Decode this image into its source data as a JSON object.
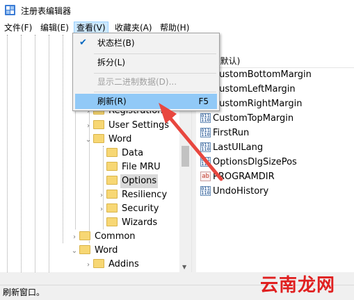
{
  "window": {
    "title": "注册表编辑器"
  },
  "menubar": [
    {
      "label": "文件(F)"
    },
    {
      "label": "编辑(E)"
    },
    {
      "label": "查看(V)"
    },
    {
      "label": "收藏夹(A)"
    },
    {
      "label": "帮助(H)"
    }
  ],
  "view_menu": {
    "items": [
      {
        "label": "状态栏(B)",
        "checked": true,
        "enabled": true
      },
      {
        "label": "拆分(L)",
        "enabled": true
      },
      {
        "label": "显示二进制数据(D)...",
        "enabled": false
      },
      {
        "label": "刷新(R)",
        "shortcut": "F5",
        "enabled": true,
        "highlighted": true
      }
    ]
  },
  "tree": {
    "rows": [
      {
        "label": "Registration",
        "expander": "›"
      },
      {
        "label": "User Settings",
        "expander": "›"
      },
      {
        "label": "Word",
        "expander": "⌄"
      },
      {
        "label": "Data",
        "expander": ""
      },
      {
        "label": "File MRU",
        "expander": ""
      },
      {
        "label": "Options",
        "expander": "",
        "selected": true
      },
      {
        "label": "Resiliency",
        "expander": "›"
      },
      {
        "label": "Security",
        "expander": "›"
      },
      {
        "label": "Wizards",
        "expander": ""
      },
      {
        "label": "Common",
        "expander": "›"
      },
      {
        "label": "Word",
        "expander": "⌄"
      },
      {
        "label": "Addins",
        "expander": "›"
      }
    ]
  },
  "values": {
    "header": "(默认)",
    "rows": [
      {
        "name": "CustomBottomMargin",
        "icon": "binary-value-icon"
      },
      {
        "name": "CustomLeftMargin",
        "icon": "binary-value-icon"
      },
      {
        "name": "CustomRightMargin",
        "icon": "binary-value-icon"
      },
      {
        "name": "CustomTopMargin",
        "icon": "binary-value-icon"
      },
      {
        "name": "FirstRun",
        "icon": "binary-value-icon"
      },
      {
        "name": "LastUILang",
        "icon": "binary-value-icon"
      },
      {
        "name": "OptionsDlgSizePos",
        "icon": "binary-value-icon"
      },
      {
        "name": "PROGRAMDIR",
        "icon": "string-value-icon"
      },
      {
        "name": "UndoHistory",
        "icon": "binary-value-icon"
      }
    ]
  },
  "icons": {
    "check": "✔",
    "binary_glyph": "011\n110",
    "string_glyph": "ab"
  },
  "statusbar": {
    "text": "刷新窗口。"
  },
  "watermark": {
    "text": "云南龙网"
  },
  "colors": {
    "highlight": "#91c9f7",
    "menu_active": "#cce8ff",
    "arrow": "#e8473f",
    "watermark": "#e02020"
  }
}
